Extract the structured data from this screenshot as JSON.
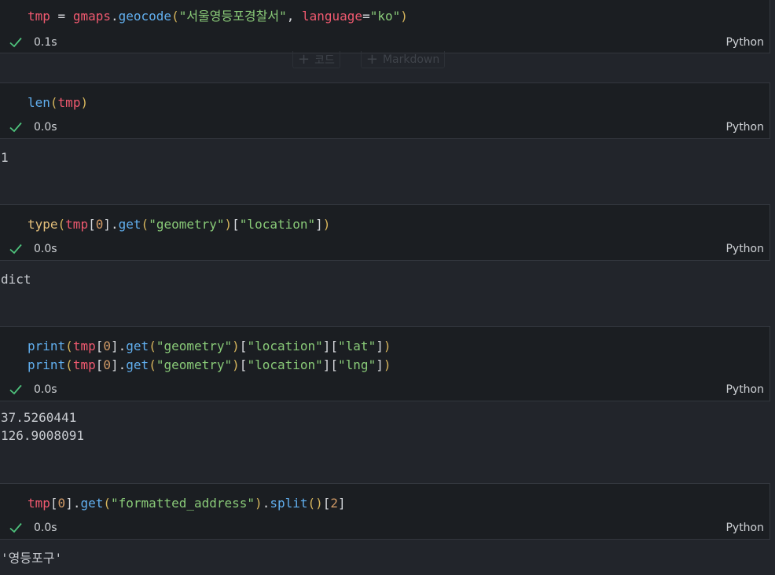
{
  "cells": [
    {
      "code_lines": [
        "tmp = gmaps.geocode(\"서울영등포경찰서\", language=\"ko\")"
      ],
      "tokens": {
        "a": "tmp",
        "b": " = ",
        "c": "gmaps",
        "d": ".",
        "e": "geocode",
        "f": "(",
        "g": "\"서울영등포경찰서\"",
        "h": ", ",
        "i": "language",
        "j": "=",
        "k": "\"ko\"",
        "l": ")"
      },
      "time": "0.1s",
      "language": "Python",
      "output": ""
    },
    {
      "tokens": {
        "a": "len",
        "b": "(",
        "c": "tmp",
        "d": ")"
      },
      "time": "0.0s",
      "language": "Python",
      "output": "1"
    },
    {
      "tokens": {
        "a": "type",
        "b": "(",
        "c": "tmp",
        "d": "[",
        "e": "0",
        "f": "]",
        "g": ".",
        "h": "get",
        "i": "(",
        "j": "\"geometry\"",
        "k": ")",
        "l": "[",
        "m": "\"location\"",
        "n": "]",
        "o": ")"
      },
      "time": "0.0s",
      "language": "Python",
      "output": "dict"
    },
    {
      "tokens_1": {
        "a": "print",
        "b": "(",
        "c": "tmp",
        "d": "[",
        "e": "0",
        "f": "]",
        "g": ".",
        "h": "get",
        "i": "(",
        "j": "\"geometry\"",
        "k": ")",
        "l": "[",
        "m": "\"location\"",
        "n": "][",
        "o": "\"lat\"",
        "p": "]",
        "q": ")"
      },
      "tokens_2": {
        "a": "print",
        "b": "(",
        "c": "tmp",
        "d": "[",
        "e": "0",
        "f": "]",
        "g": ".",
        "h": "get",
        "i": "(",
        "j": "\"geometry\"",
        "k": ")",
        "l": "[",
        "m": "\"location\"",
        "n": "][",
        "o": "\"lng\"",
        "p": "]",
        "q": ")"
      },
      "time": "0.0s",
      "language": "Python",
      "output_lines": [
        "37.5260441",
        "126.9008091"
      ]
    },
    {
      "tokens": {
        "a": "tmp",
        "b": "[",
        "c": "0",
        "d": "]",
        "e": ".",
        "f": "get",
        "g": "(",
        "h": "\"formatted_address\"",
        "i": ")",
        "j": ".",
        "k": "split",
        "l": "()",
        "m": "[",
        "n": "2",
        "o": "]"
      },
      "time": "0.0s",
      "language": "Python",
      "output": "'영등포구'"
    }
  ],
  "add_bar": {
    "code_label": "코드",
    "markdown_label": "Markdown"
  },
  "colors": {
    "variable": "#ef596f",
    "function": "#61afef",
    "string": "#89ca78",
    "type": "#e5c07b",
    "success_check": "#4ec27c"
  }
}
